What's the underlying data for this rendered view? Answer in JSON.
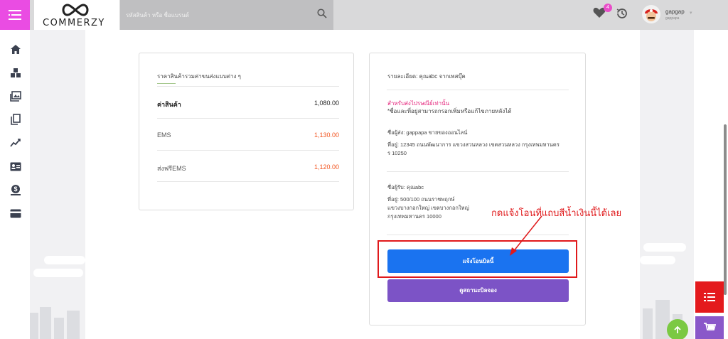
{
  "header": {
    "logo_text": "COMMERZY",
    "search_placeholder": "รหัสสินค้า หรือ ชื่อแบรนด์",
    "wishlist_count": "4",
    "user_name": "gapgap",
    "user_sub": "gappapa"
  },
  "sidebar": {
    "items": [
      "home-icon",
      "boxes-icon",
      "gallery-icon",
      "copy-icon",
      "chart-icon",
      "id-card-icon",
      "money-icon",
      "card-icon"
    ]
  },
  "summary": {
    "title": "ราคาสินค้ารวมค่าขนส่งแบบต่าง ๆ",
    "rows": [
      {
        "label": "ค่าสินค้า",
        "value": "1,080.00"
      },
      {
        "label": "EMS",
        "value": "1,130.00"
      },
      {
        "label": "ส่งฟรีEMS",
        "value": "1,120.00"
      }
    ]
  },
  "detail": {
    "title": "รายละเอียด: คุณabc จากเพสบุ๊ค",
    "note_red": "สำหรับส่งไปรษณีย์เท่านั้น",
    "note": "*ชื่อและที่อยู่สามารถกรอกเพิ่มหรือแก้ไขภายหลังได้",
    "sender_name": "ชื่อผู้ส่ง: gappapa ขายของออนไลน์",
    "sender_addr_1": "ที่อยู่: 12345 ถนนพัฒนาการ แขวงสวนหลวง เขตสวนหลวง กรุงเทพมหานคร",
    "sender_addr_2": "ร 10250",
    "receiver_name": "ชื่อผู้รับ: คุณabc",
    "receiver_addr_1": "ที่อยู่: 500/100 ถนนราชพฤกษ์",
    "receiver_addr_2": "แขวงบางกอกใหญ่ เขตบางกอกใหญ่",
    "receiver_addr_3": "กรุงเทพมหานคร 10000",
    "pay_button": "แจ้งโอนบิลนี้",
    "status_button": "ดูสถานะบิลจอง"
  },
  "annotation": {
    "text": "กดแจ้งโอนที่แถบสีน้ำเงินนี้ได้เลย"
  },
  "colors": {
    "menu": "#ea4ce3",
    "primary_blue": "#1a73f0",
    "purple": "#7c53c6",
    "red_price": "#f2531e",
    "annotation_red": "#e0191b"
  }
}
